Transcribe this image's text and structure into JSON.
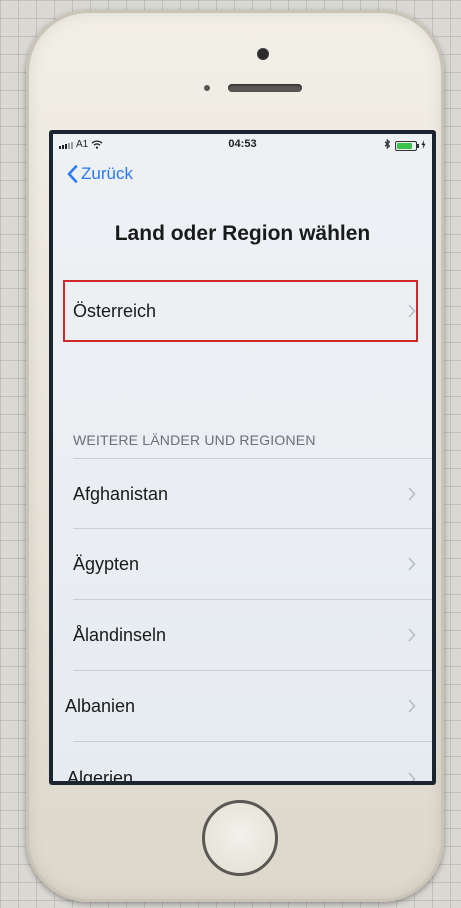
{
  "status_bar": {
    "carrier": "A1",
    "time": "04:53"
  },
  "nav": {
    "back_label": "Zurück"
  },
  "header": {
    "title": "Land oder Region wählen"
  },
  "suggested": {
    "label": "Österreich"
  },
  "section": {
    "title": "WEITERE LÄNDER UND REGIONEN"
  },
  "countries": [
    {
      "label": "Afghanistan"
    },
    {
      "label": "Ägypten"
    },
    {
      "label": "Ålandinseln"
    },
    {
      "label": "Albanien"
    },
    {
      "label": "Algerien"
    }
  ],
  "colors": {
    "accent": "#2a7af5",
    "highlight": "#d1262c",
    "battery": "#3bc24a"
  },
  "icons": {
    "back": "chevron-left-icon",
    "row": "chevron-right-icon",
    "signal": "signal-icon",
    "wifi": "wifi-icon",
    "bluetooth": "bluetooth-icon",
    "battery": "battery-icon"
  }
}
